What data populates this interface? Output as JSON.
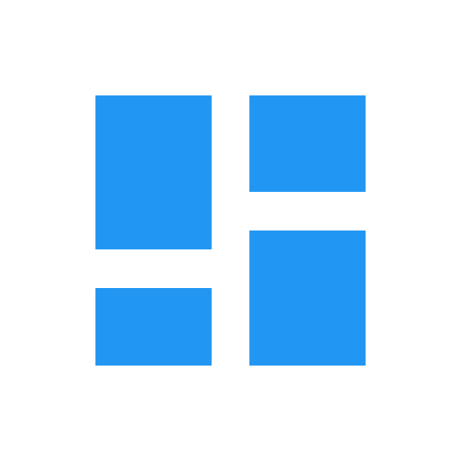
{
  "icon": {
    "name": "dashboard-layout-icon",
    "color": "#2196F3",
    "background": "#ffffff"
  }
}
